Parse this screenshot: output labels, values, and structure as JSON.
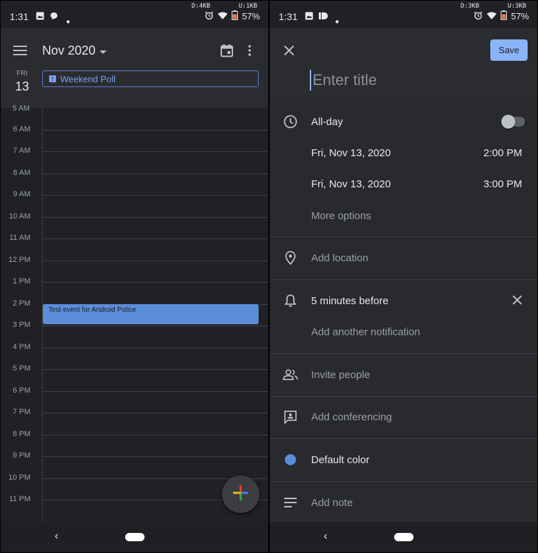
{
  "left_status": {
    "time": "1:31",
    "net_down": "D:4KB",
    "net_up": "U:1KB",
    "battery": "57%"
  },
  "right_status": {
    "time": "1:31",
    "net_down": "D:3KB",
    "net_up": "U:3KB",
    "battery": "57%"
  },
  "calendar": {
    "month_label": "Nov 2020",
    "day_name": "FRI",
    "day_number": "13",
    "all_day_event": "Weekend Poll",
    "partial_hour": "5 AM",
    "hours": [
      "6 AM",
      "7 AM",
      "8 AM",
      "9 AM",
      "10 AM",
      "11 AM",
      "12 PM",
      "1 PM",
      "2 PM",
      "3 PM",
      "4 PM",
      "5 PM",
      "6 PM",
      "7 PM",
      "8 PM",
      "9 PM",
      "10 PM",
      "11 PM"
    ],
    "event_title": "Test event for Android Police"
  },
  "editor": {
    "save_label": "Save",
    "title_placeholder": "Enter title",
    "all_day_label": "All-day",
    "all_day_on": false,
    "start_date": "Fri, Nov 13, 2020",
    "start_time": "2:00 PM",
    "end_date": "Fri, Nov 13, 2020",
    "end_time": "3:00 PM",
    "more_options": "More options",
    "add_location": "Add location",
    "notification": "5 minutes before",
    "add_notification": "Add another notification",
    "invite_people": "Invite people",
    "add_conferencing": "Add conferencing",
    "default_color": "Default color",
    "add_note": "Add note"
  },
  "colors": {
    "accent": "#8ab4f8",
    "event_blue": "#5b8dd9",
    "background": "#202124"
  }
}
